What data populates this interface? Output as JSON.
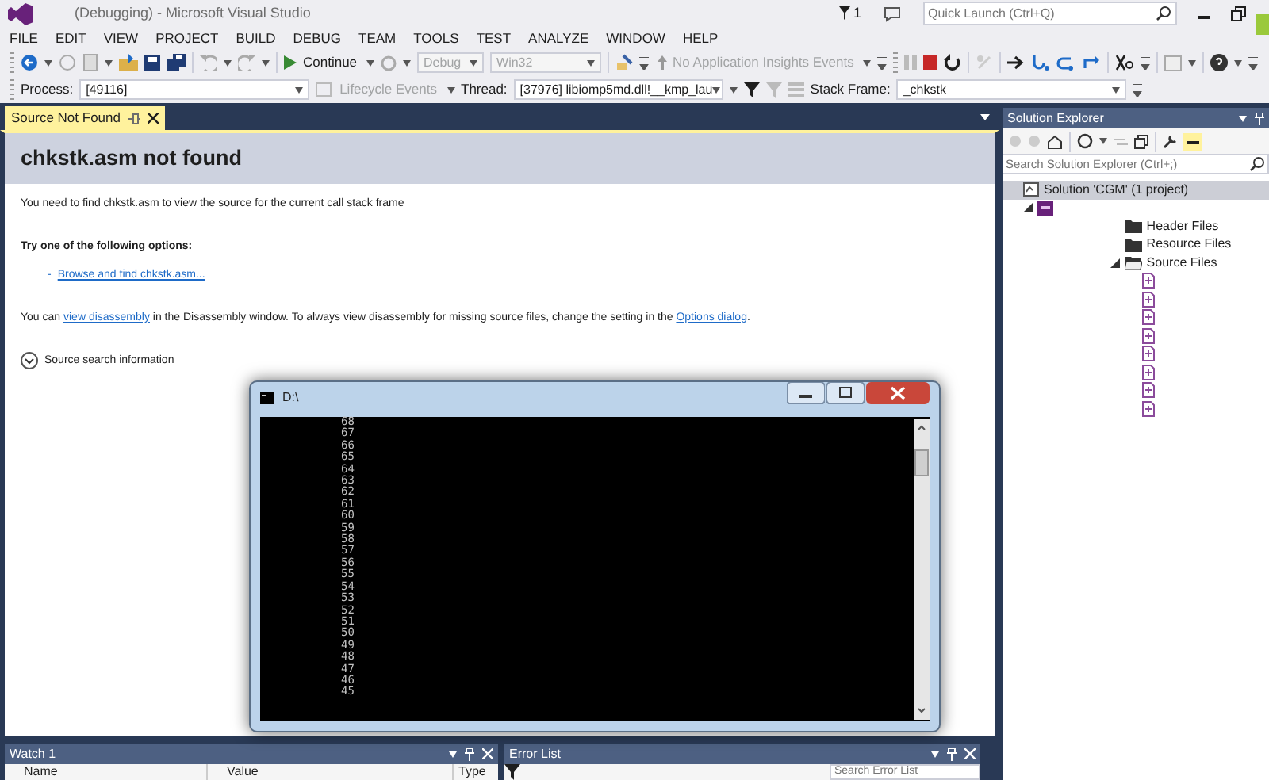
{
  "window": {
    "title": "(Debugging) - Microsoft Visual Studio",
    "notification_count": "1",
    "quick_launch": {
      "placeholder": "Quick Launch (Ctrl+Q)"
    }
  },
  "menu": [
    "FILE",
    "EDIT",
    "VIEW",
    "PROJECT",
    "BUILD",
    "DEBUG",
    "TEAM",
    "TOOLS",
    "TEST",
    "ANALYZE",
    "WINDOW",
    "HELP"
  ],
  "debug_toolbar": [
    {
      "kind": "button",
      "label": "Continue",
      "disabled": false
    },
    {
      "kind": "combo",
      "value": "Debug",
      "disabled": true
    },
    {
      "kind": "combo",
      "value": "Win32",
      "disabled": true
    },
    {
      "kind": "button",
      "label": "No Application Insights Events",
      "disabled": true
    }
  ],
  "location_toolbar": [
    {
      "kind": "label",
      "label": "Process:"
    },
    {
      "kind": "combo",
      "value": "[49116]",
      "disabled": false
    },
    {
      "kind": "button",
      "label": "Lifecycle Events",
      "disabled": true
    },
    {
      "kind": "label",
      "label": "Thread:"
    },
    {
      "kind": "combo",
      "value": "[37976] libiomp5md.dll!__kmp_lau",
      "disabled": false
    },
    {
      "kind": "label",
      "label": "Stack Frame:"
    },
    {
      "kind": "combo",
      "value": "_chkstk",
      "disabled": false
    }
  ],
  "document_tabs": [
    {
      "label": "Source Not Found",
      "selected": true
    }
  ],
  "document": {
    "heading": "chkstk.asm not found",
    "message": "You need to find chkstk.asm to view the source for the current call stack frame",
    "options_heading": "Try one of the following options:",
    "options": [
      {
        "bullet": "-",
        "link": "Browse and find chkstk.asm..."
      }
    ],
    "note": [
      {
        "text": "You can ",
        "link": false
      },
      {
        "text": "view disassembly",
        "link": true
      },
      {
        "text": " in the Disassembly window. To always view disassembly for missing source files, change the setting in the ",
        "link": false
      },
      {
        "text": "Options dialog",
        "link": true
      },
      {
        "text": ".",
        "link": false
      }
    ],
    "source_search": {
      "label": "Source search information",
      "expanded": false
    }
  },
  "console": {
    "title": "D:\\",
    "lines": [
      "68",
      "67",
      "66",
      "65",
      "64",
      "63",
      "62",
      "61",
      "60",
      "59",
      "58",
      "57",
      "56",
      "55",
      "54",
      "53",
      "52",
      "51",
      "50",
      "49",
      "48",
      "47",
      "46",
      "45"
    ]
  },
  "solution_explorer": {
    "title": "Solution Explorer",
    "search": {
      "placeholder": "Search Solution Explorer (Ctrl+;)"
    },
    "tree": [
      {
        "kind": "solution",
        "label": "Solution 'CGM' (1 project)",
        "children": [
          {
            "kind": "project",
            "expanded": true,
            "children": [
              {
                "kind": "folder",
                "label": "Header Files",
                "expanded": false
              },
              {
                "kind": "folder",
                "label": "Resource Files",
                "expanded": false
              },
              {
                "kind": "folder",
                "label": "Source Files",
                "expanded": true,
                "children": [
                  {
                    "kind": "file"
                  },
                  {
                    "kind": "file"
                  },
                  {
                    "kind": "file"
                  },
                  {
                    "kind": "file"
                  },
                  {
                    "kind": "file"
                  },
                  {
                    "kind": "file"
                  },
                  {
                    "kind": "file"
                  },
                  {
                    "kind": "file"
                  }
                ]
              }
            ]
          }
        ]
      }
    ]
  },
  "watch": {
    "title": "Watch 1",
    "columns": [
      "Name",
      "Value",
      "Type"
    ]
  },
  "error_list": {
    "title": "Error List",
    "search": {
      "placeholder": "Search Error List"
    }
  }
}
